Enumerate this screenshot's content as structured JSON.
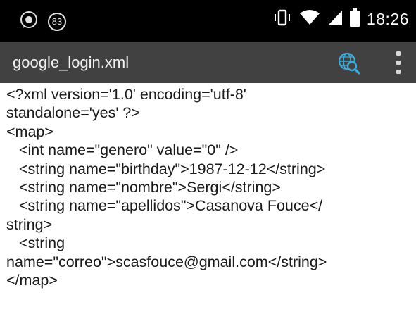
{
  "status_bar": {
    "left_icons": [
      "whatsapp-icon",
      "notification-count-icon"
    ],
    "notification_count": "83",
    "right_icons": [
      "vibrate-icon",
      "wifi-icon",
      "signal-icon",
      "battery-icon"
    ],
    "time": "18:26"
  },
  "app_bar": {
    "title": "google_login.xml",
    "search_icon": "web-search-icon",
    "overflow_icon": "more-vert-icon",
    "accent_color": "#3fa9d8"
  },
  "file_content": {
    "lines": [
      "<?xml version='1.0' encoding='utf-8'",
      "standalone='yes' ?>",
      "<map>",
      "   <int name=\"genero\" value=\"0\" />",
      "   <string name=\"birthday\">1987-12-12</string>",
      "   <string name=\"nombre\">Sergi</string>",
      "   <string name=\"apellidos\">Casanova Fouce</",
      "string>",
      "   <string",
      "name=\"correo\">scasfouce@gmail.com</string>",
      "</map>"
    ]
  }
}
